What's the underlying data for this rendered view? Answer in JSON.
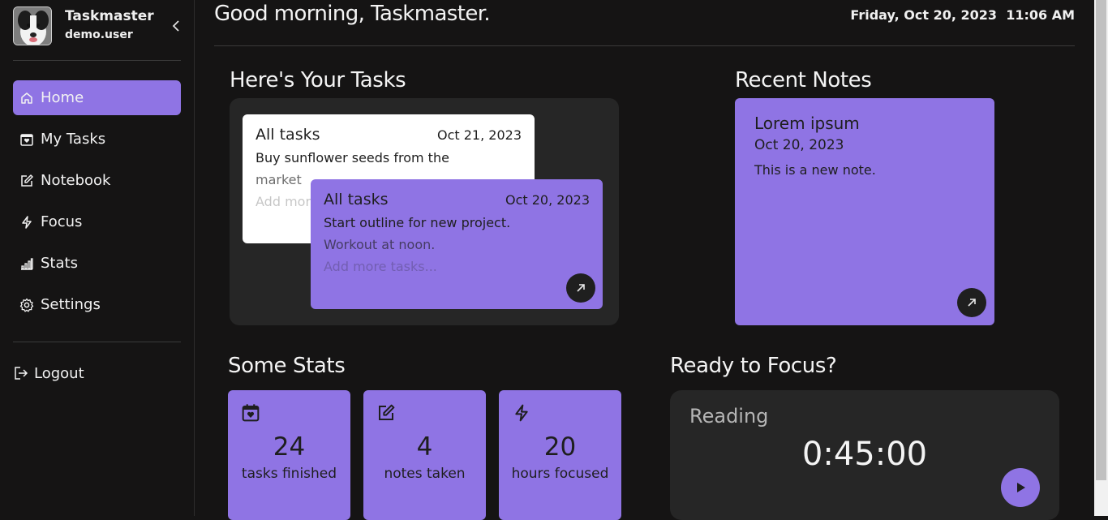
{
  "user": {
    "app_name": "Taskmaster",
    "username": "demo.user"
  },
  "nav": [
    {
      "label": "Home",
      "icon": "home-icon",
      "active": true
    },
    {
      "label": "My Tasks",
      "icon": "calendar-heart-icon"
    },
    {
      "label": "Notebook",
      "icon": "edit-icon"
    },
    {
      "label": "Focus",
      "icon": "lightning-icon"
    },
    {
      "label": "Stats",
      "icon": "bar-chart-icon"
    },
    {
      "label": "Settings",
      "icon": "gear-icon"
    }
  ],
  "logout_label": "Logout",
  "header": {
    "greeting": "Good morning, Taskmaster.",
    "datetime": "Friday, Oct 20, 2023  11:06 AM"
  },
  "tasks": {
    "title": "Here's Your Tasks",
    "cards": [
      {
        "title": "All tasks",
        "date": "Oct 21, 2023",
        "lines": [
          "Buy sunflower seeds from the",
          "market"
        ],
        "more": "Add more tasks..."
      },
      {
        "title": "All tasks",
        "date": "Oct 20, 2023",
        "lines": [
          "Start outline for new project.",
          "Workout at noon."
        ],
        "more": "Add more tasks..."
      }
    ]
  },
  "notes": {
    "title": "Recent Notes",
    "card": {
      "title": "Lorem ipsum",
      "date": "Oct 20, 2023",
      "body": "This is a new note."
    }
  },
  "stats": {
    "title": "Some Stats",
    "items": [
      {
        "value": "24",
        "label": "tasks finished",
        "icon": "calendar-heart-icon"
      },
      {
        "value": "4",
        "label": "notes taken",
        "icon": "edit-icon"
      },
      {
        "value": "20",
        "label": "hours focused",
        "icon": "lightning-icon"
      }
    ]
  },
  "focus": {
    "title": "Ready to Focus?",
    "label": "Reading",
    "time": "0:45:00"
  },
  "colors": {
    "accent": "#8f74e4",
    "background": "#151414",
    "panel": "#262626"
  }
}
